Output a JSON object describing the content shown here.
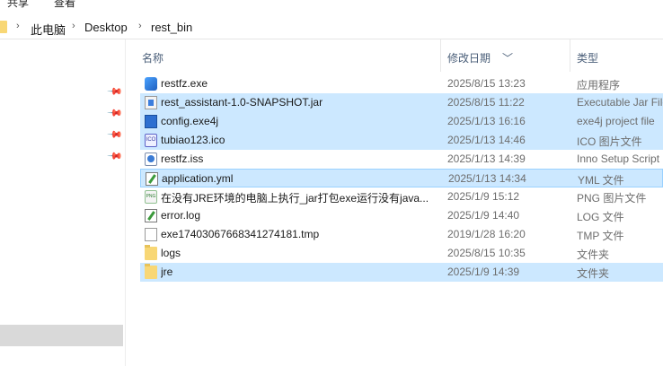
{
  "ribbon": {
    "tab_share": "共享",
    "tab_view": "查看"
  },
  "address": {
    "segments": [
      "此电脑",
      "Desktop",
      "rest_bin"
    ]
  },
  "columns": {
    "name": "名称",
    "date": "修改日期",
    "type": "类型"
  },
  "files": [
    {
      "name": "restfz.exe",
      "date": "2025/8/15 13:23",
      "type": "应用程序",
      "icon": "exe-icon",
      "selected": false
    },
    {
      "name": "rest_assistant-1.0-SNAPSHOT.jar",
      "date": "2025/8/15 11:22",
      "type": "Executable Jar File",
      "icon": "jar-icon",
      "selected": true
    },
    {
      "name": "config.exe4j",
      "date": "2025/1/13 16:16",
      "type": "exe4j project file",
      "icon": "exe4j-icon",
      "selected": true
    },
    {
      "name": "tubiao123.ico",
      "date": "2025/1/13 14:46",
      "type": "ICO 图片文件",
      "icon": "ico-file-icon",
      "icon_text": "ICO",
      "selected": true
    },
    {
      "name": "restfz.iss",
      "date": "2025/1/13 14:39",
      "type": "Inno Setup Script",
      "icon": "iss-icon",
      "selected": false
    },
    {
      "name": "application.yml",
      "date": "2025/1/13 14:34",
      "type": "YML 文件",
      "icon": "yml-icon",
      "selected": true,
      "focused": true
    },
    {
      "name": "在没有JRE环境的电脑上执行_jar打包exe运行没有java...",
      "date": "2025/1/9 15:12",
      "type": "PNG 图片文件",
      "icon": "png-icon",
      "icon_text": "PNG",
      "selected": false
    },
    {
      "name": "error.log",
      "date": "2025/1/9 14:40",
      "type": "LOG 文件",
      "icon": "log-icon",
      "selected": false
    },
    {
      "name": "exe17403067668341274181.tmp",
      "date": "2019/1/28 16:20",
      "type": "TMP 文件",
      "icon": "tmp-file-icon",
      "selected": false
    },
    {
      "name": "logs",
      "date": "2025/8/15 10:35",
      "type": "文件夹",
      "icon": "folder-icon",
      "selected": false
    },
    {
      "name": "jre",
      "date": "2025/1/9 14:39",
      "type": "文件夹",
      "icon": "folder-icon",
      "selected": true
    }
  ],
  "colors": {
    "selection": "#cce8ff",
    "selection_border": "#99d1ff",
    "header_text": "#4c607a",
    "folder": "#f8d775"
  }
}
